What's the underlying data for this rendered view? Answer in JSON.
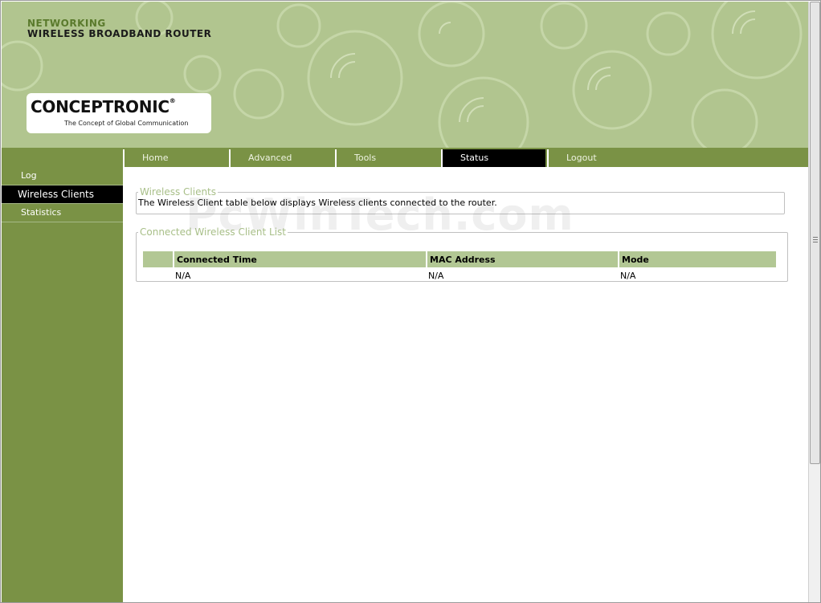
{
  "header": {
    "brand_line1": "NETWORKING",
    "brand_line2": "WIRELESS BROADBAND ROUTER",
    "logo_text": "CONCEPTRONIC",
    "logo_registered": "®",
    "logo_tagline": "The Concept of Global Communication"
  },
  "nav": {
    "tabs": [
      {
        "label": "Home"
      },
      {
        "label": "Advanced"
      },
      {
        "label": "Tools"
      },
      {
        "label": "Status",
        "active": true
      },
      {
        "label": "Logout"
      }
    ]
  },
  "sidebar": {
    "items": [
      {
        "label": "Log"
      },
      {
        "label": "Wireless Clients",
        "active": true
      },
      {
        "label": "Statistics"
      }
    ]
  },
  "main": {
    "wireless_clients": {
      "legend": "Wireless Clients",
      "description": "The Wireless Client table below displays Wireless clients connected to the router."
    },
    "client_list": {
      "legend": "Connected Wireless Client List",
      "columns": [
        "",
        "Connected Time",
        "MAC Address",
        "Mode"
      ],
      "rows": [
        [
          "",
          "N/A",
          "N/A",
          "N/A"
        ]
      ]
    }
  },
  "watermark": "PcWinTech.com",
  "colors": {
    "header_bg": "#b1c58f",
    "nav_green": "#7a9245",
    "active_black": "#000000",
    "legend_green": "#a8bf88",
    "table_header": "#b2c794"
  }
}
